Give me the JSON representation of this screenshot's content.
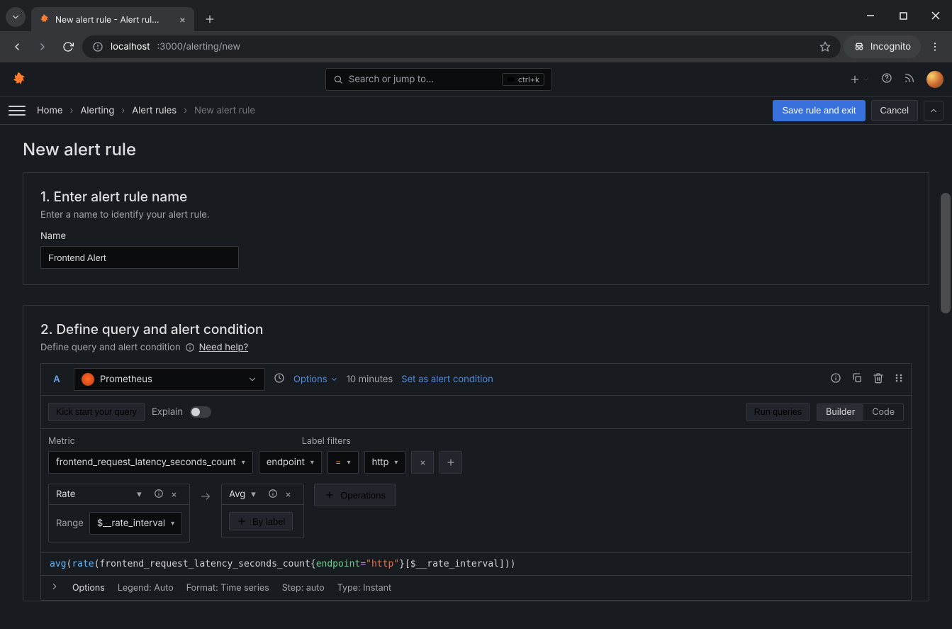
{
  "browser": {
    "tab_title": "New alert rule - Alert rul…",
    "url_host": "localhost",
    "url_path": ":3000/alerting/new",
    "incognito": "Incognito"
  },
  "topbar": {
    "search_placeholder": "Search or jump to...",
    "shortcut": "ctrl+k"
  },
  "breadcrumbs": {
    "items": [
      "Home",
      "Alerting",
      "Alert rules"
    ],
    "current": "New alert rule",
    "save": "Save rule and exit",
    "cancel": "Cancel"
  },
  "page": {
    "title": "New alert rule"
  },
  "section1": {
    "heading": "1. Enter alert rule name",
    "sub": "Enter a name to identify your alert rule.",
    "name_label": "Name",
    "name_value": "Frontend Alert"
  },
  "section2": {
    "heading": "2. Define query and alert condition",
    "sub": "Define query and alert condition",
    "help": "Need help?"
  },
  "query": {
    "letter": "A",
    "datasource": "Prometheus",
    "options_label": "Options",
    "time_range": "10 minutes",
    "set_condition": "Set as alert condition",
    "kick": "Kick start your query",
    "explain": "Explain",
    "run": "Run queries",
    "builder": "Builder",
    "code": "Code",
    "metric_label": "Metric",
    "metric_value": "frontend_request_latency_seconds_count",
    "filters_label": "Label filters",
    "filter_key": "endpoint",
    "filter_op": "=",
    "filter_val": "http",
    "op_rate": "Rate",
    "op_avg": "Avg",
    "operations_btn": "Operations",
    "range_label": "Range",
    "range_value": "$__rate_interval",
    "by_label": "By label",
    "promql_parts": {
      "avg": "avg",
      "rate": "rate",
      "metric": "frontend_request_latency_seconds_count",
      "key": "endpoint",
      "eq": "=",
      "val": "\"http\"",
      "range": "$__rate_interval"
    },
    "footer": {
      "options": "Options",
      "legend": "Legend: Auto",
      "format": "Format: Time series",
      "step": "Step: auto",
      "type": "Type: Instant"
    }
  }
}
